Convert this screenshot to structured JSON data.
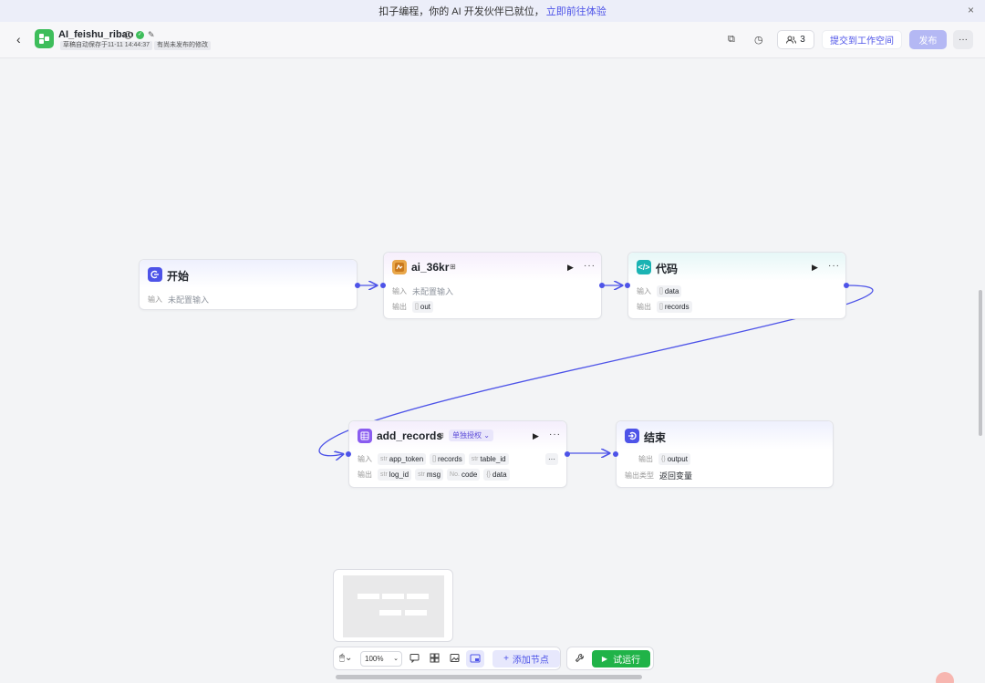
{
  "banner": {
    "text": "扣子编程，你的 AI 开发伙伴已就位，",
    "link": "立即前往体验",
    "close_icon": "×"
  },
  "header": {
    "back_icon": "‹",
    "app_name": "AI_feishu_ribao",
    "info_icon": "i",
    "status_icon": "✓",
    "edit_icon": "✎",
    "draft_tag": "草稿自动保存于11-11 14:44:37",
    "unpublished_tag": "有尚未发布的修改",
    "copy_icon": "⧉",
    "history_icon": "◷",
    "collab_icon": "👥",
    "collab_count": "3",
    "submit_label": "提交到工作空间",
    "publish_label": "发布",
    "more_label": "···"
  },
  "nodes": {
    "start": {
      "title": "开始",
      "input_label": "输入",
      "input_value": "未配置输入"
    },
    "ai36kr": {
      "title": "ai_36kr",
      "input_label": "输入",
      "input_value": "未配置输入",
      "output_label": "输出",
      "output_chip_type": "[]",
      "output_chip": "out",
      "run_icon": "▶",
      "more_icon": "···"
    },
    "code": {
      "title": "代码",
      "icon_text": "</>",
      "input_label": "输入",
      "input_chip_type": "[]",
      "input_chip": "data",
      "output_label": "输出",
      "output_chip_type": "[]",
      "output_chip": "records",
      "run_icon": "▶",
      "more_icon": "···"
    },
    "add_records": {
      "title": "add_records",
      "auth_tag": "单独授权",
      "input_label": "输入",
      "inputs": [
        {
          "type": "str",
          "name": "app_token"
        },
        {
          "type": "[]",
          "name": "records"
        },
        {
          "type": "str",
          "name": "table_id"
        }
      ],
      "inputs_more": "···",
      "output_label": "输出",
      "outputs": [
        {
          "type": "str",
          "name": "log_id"
        },
        {
          "type": "str",
          "name": "msg"
        },
        {
          "type": "No.",
          "name": "code"
        },
        {
          "type": "{}",
          "name": "data"
        }
      ],
      "run_icon": "▶",
      "more_icon": "···"
    },
    "end": {
      "title": "结束",
      "output_label": "输出",
      "output_chip_type": "{}",
      "output_chip": "output",
      "output_type_label": "输出类型",
      "output_type_value": "返回变量"
    }
  },
  "toolbar": {
    "mouse_icon": "🖱",
    "zoom": "100%",
    "add_node_label": "添加节点",
    "add_icon": "+",
    "trial_label": "试运行",
    "trial_icon": "▶",
    "wrench_icon": "🔧"
  },
  "colors": {
    "accent": "#4d53e8",
    "green": "#20b348",
    "publish": "#b4b8f4"
  }
}
